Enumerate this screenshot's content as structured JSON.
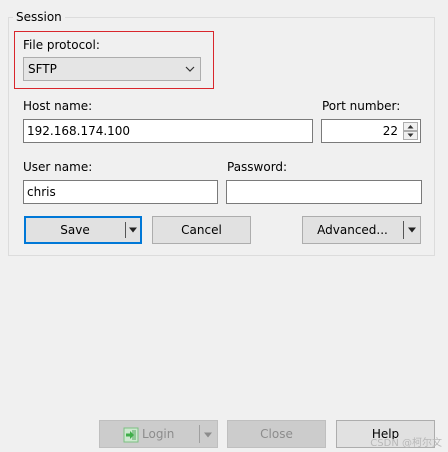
{
  "session": {
    "group_title": "Session",
    "file_protocol_label": "File protocol:",
    "file_protocol_value": "SFTP",
    "host_name_label": "Host name:",
    "host_name_value": "192.168.174.100",
    "port_number_label": "Port number:",
    "port_number_value": "22",
    "user_name_label": "User name:",
    "user_name_value": "chris",
    "password_label": "Password:",
    "password_value": ""
  },
  "buttons": {
    "save": "Save",
    "cancel": "Cancel",
    "advanced": "Advanced...",
    "login": "Login",
    "close": "Close",
    "help": "Help"
  },
  "watermark": "CSDN @柯尔文",
  "colors": {
    "highlight_border": "#d9262c",
    "default_button_border": "#0078d7",
    "login_icon": "#3fae49"
  },
  "icons": {
    "combo_arrow": "chevron-down-icon",
    "split_arrow": "caret-down-icon",
    "spin_up": "caret-up-icon",
    "spin_down": "caret-down-icon",
    "login": "login-icon"
  }
}
